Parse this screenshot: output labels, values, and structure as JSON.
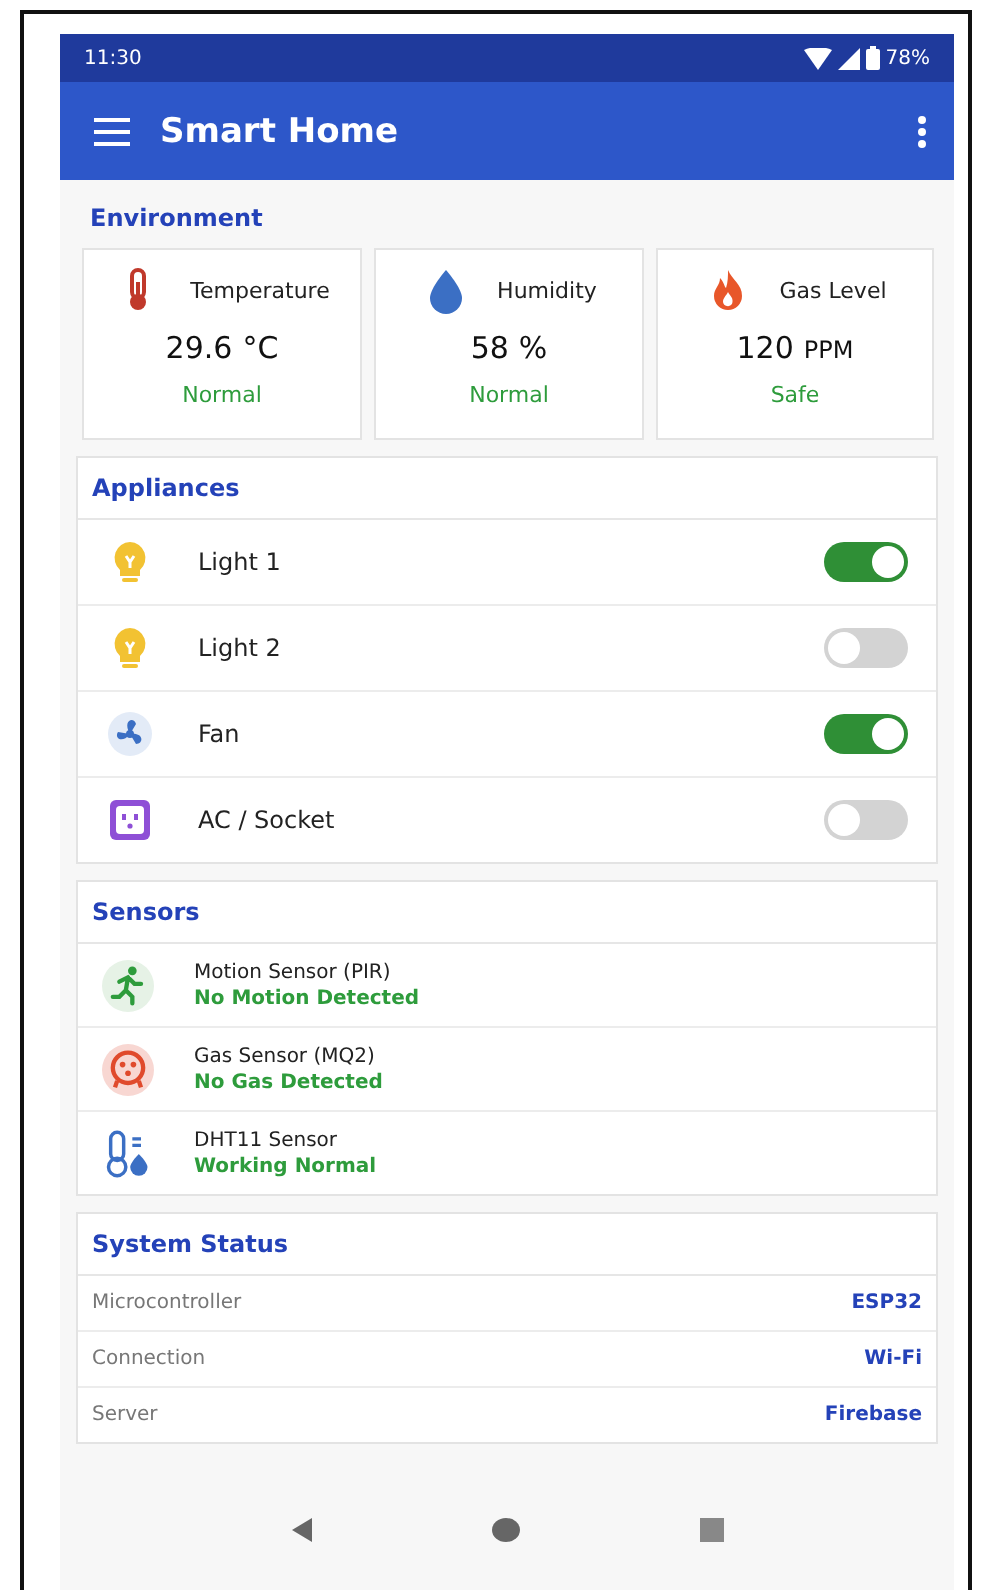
{
  "status_bar": {
    "time": "11:30",
    "battery": "78%"
  },
  "app_bar": {
    "title": "Smart Home"
  },
  "environment": {
    "title": "Environment",
    "cards": [
      {
        "kind": "temperature",
        "label": "Temperature",
        "value": "29.6",
        "unit": "°C",
        "status": "Normal"
      },
      {
        "kind": "humidity",
        "label": "Humidity",
        "value": "58",
        "unit": "%",
        "status": "Normal"
      },
      {
        "kind": "gas",
        "label": "Gas Level",
        "value": "120",
        "unit": "PPM",
        "status": "Safe"
      }
    ]
  },
  "appliances": {
    "title": "Appliances",
    "items": [
      {
        "kind": "light",
        "name": "Light 1",
        "on": true
      },
      {
        "kind": "light",
        "name": "Light 2",
        "on": false
      },
      {
        "kind": "fan",
        "name": "Fan",
        "on": true
      },
      {
        "kind": "socket",
        "name": "AC / Socket",
        "on": false
      }
    ]
  },
  "sensors": {
    "title": "Sensors",
    "items": [
      {
        "kind": "motion",
        "name": "Motion Sensor (PIR)",
        "status": "No Motion Detected"
      },
      {
        "kind": "gas",
        "name": "Gas Sensor (MQ2)",
        "status": "No Gas Detected"
      },
      {
        "kind": "dht",
        "name": "DHT11 Sensor",
        "status": "Working Normal"
      }
    ]
  },
  "system_status": {
    "title": "System Status",
    "rows": [
      {
        "label": "Microcontroller",
        "value": "ESP32"
      },
      {
        "label": "Connection",
        "value": "Wi-Fi"
      },
      {
        "label": "Server",
        "value": "Firebase"
      }
    ]
  }
}
